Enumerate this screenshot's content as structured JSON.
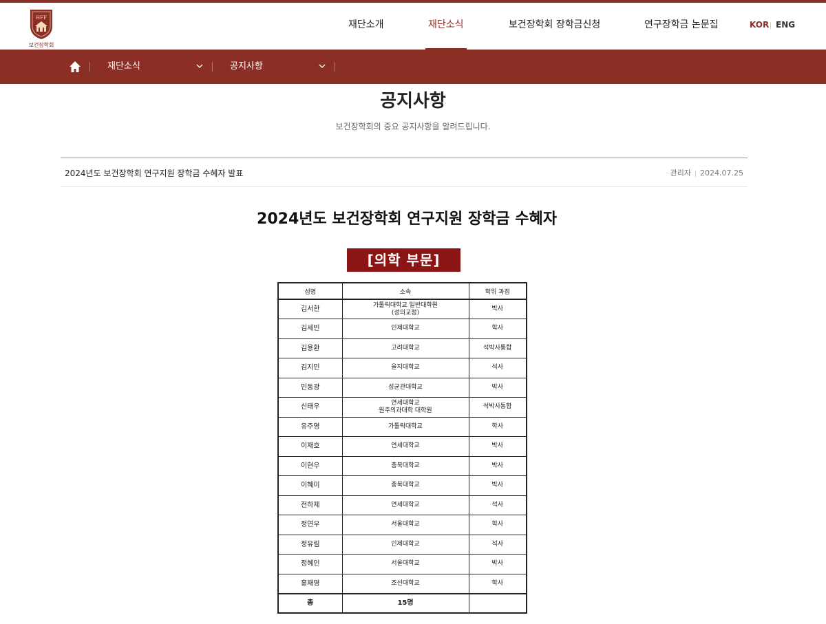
{
  "header": {
    "logo_text": "보건장학회",
    "nav": [
      "재단소개",
      "재단소식",
      "보건장학회 장학금신청",
      "연구장학금 논문집"
    ],
    "active_nav": "재단소식",
    "lang": {
      "kor": "KOR",
      "eng": "ENG"
    }
  },
  "colors": {
    "brand": "#8b2f26",
    "badge": "#8b1414"
  },
  "breadcrumb": {
    "level1": "재단소식",
    "level2": "공지사항"
  },
  "page": {
    "title": "공지사항",
    "subtitle": "보건장학회의 중요 공지사항을 알려드립니다."
  },
  "post": {
    "title": "2024년도 보건장학회 연구지원 장학금 수혜자 발표",
    "author": "관리자",
    "date": "2024.07.25"
  },
  "content": {
    "heading": "2024년도 보건장학회 연구지원 장학금 수혜자",
    "category": "[의학 부문]",
    "columns": [
      "성명",
      "소속",
      "학위 과정"
    ],
    "rows": [
      {
        "name": "김서한",
        "affiliation": "가톨릭대학교 일반대학원\n(성의교정)",
        "degree": "박사"
      },
      {
        "name": "김세빈",
        "affiliation": "인제대학교",
        "degree": "학사"
      },
      {
        "name": "김용환",
        "affiliation": "고려대학교",
        "degree": "석박사통합"
      },
      {
        "name": "김지민",
        "affiliation": "을지대학교",
        "degree": "석사"
      },
      {
        "name": "민동광",
        "affiliation": "성균관대학교",
        "degree": "박사"
      },
      {
        "name": "신태우",
        "affiliation": "연세대학교\n원주의과대학 대학원",
        "degree": "석박사통합"
      },
      {
        "name": "유주영",
        "affiliation": "가톨릭대학교",
        "degree": "학사"
      },
      {
        "name": "이재호",
        "affiliation": "연세대학교",
        "degree": "박사"
      },
      {
        "name": "이현우",
        "affiliation": "충북대학교",
        "degree": "박사"
      },
      {
        "name": "이혜미",
        "affiliation": "충북대학교",
        "degree": "박사"
      },
      {
        "name": "전하제",
        "affiliation": "연세대학교",
        "degree": "석사"
      },
      {
        "name": "정연우",
        "affiliation": "서울대학교",
        "degree": "학사"
      },
      {
        "name": "정유림",
        "affiliation": "인제대학교",
        "degree": "석사"
      },
      {
        "name": "정혜인",
        "affiliation": "서울대학교",
        "degree": "박사"
      },
      {
        "name": "홍재영",
        "affiliation": "조선대학교",
        "degree": "학사"
      }
    ],
    "total_label": "총",
    "total_value": "15명"
  }
}
